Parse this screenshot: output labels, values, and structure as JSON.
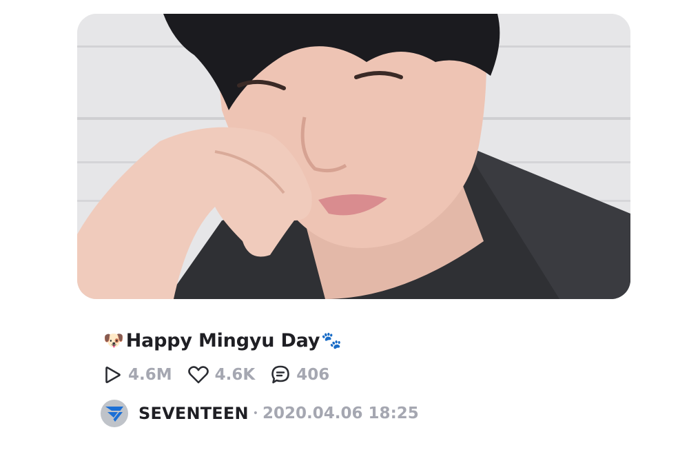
{
  "post": {
    "title_emoji_start": "🐶",
    "title": "Happy Mingyu Day",
    "title_emoji_end": "🐾",
    "thumbnail_alt": "Mingyu selfie"
  },
  "stats": {
    "plays": "4.6M",
    "likes": "4.6K",
    "comments": "406"
  },
  "author": {
    "channel": "SEVENTEEN",
    "separator": "•",
    "date": "2020.04.06 18:25"
  },
  "colors": {
    "title": "#1f1f24",
    "meta": "#a5a7b1",
    "avatar_bg": "#bfc3c9",
    "logo": "#1a6fd6"
  }
}
